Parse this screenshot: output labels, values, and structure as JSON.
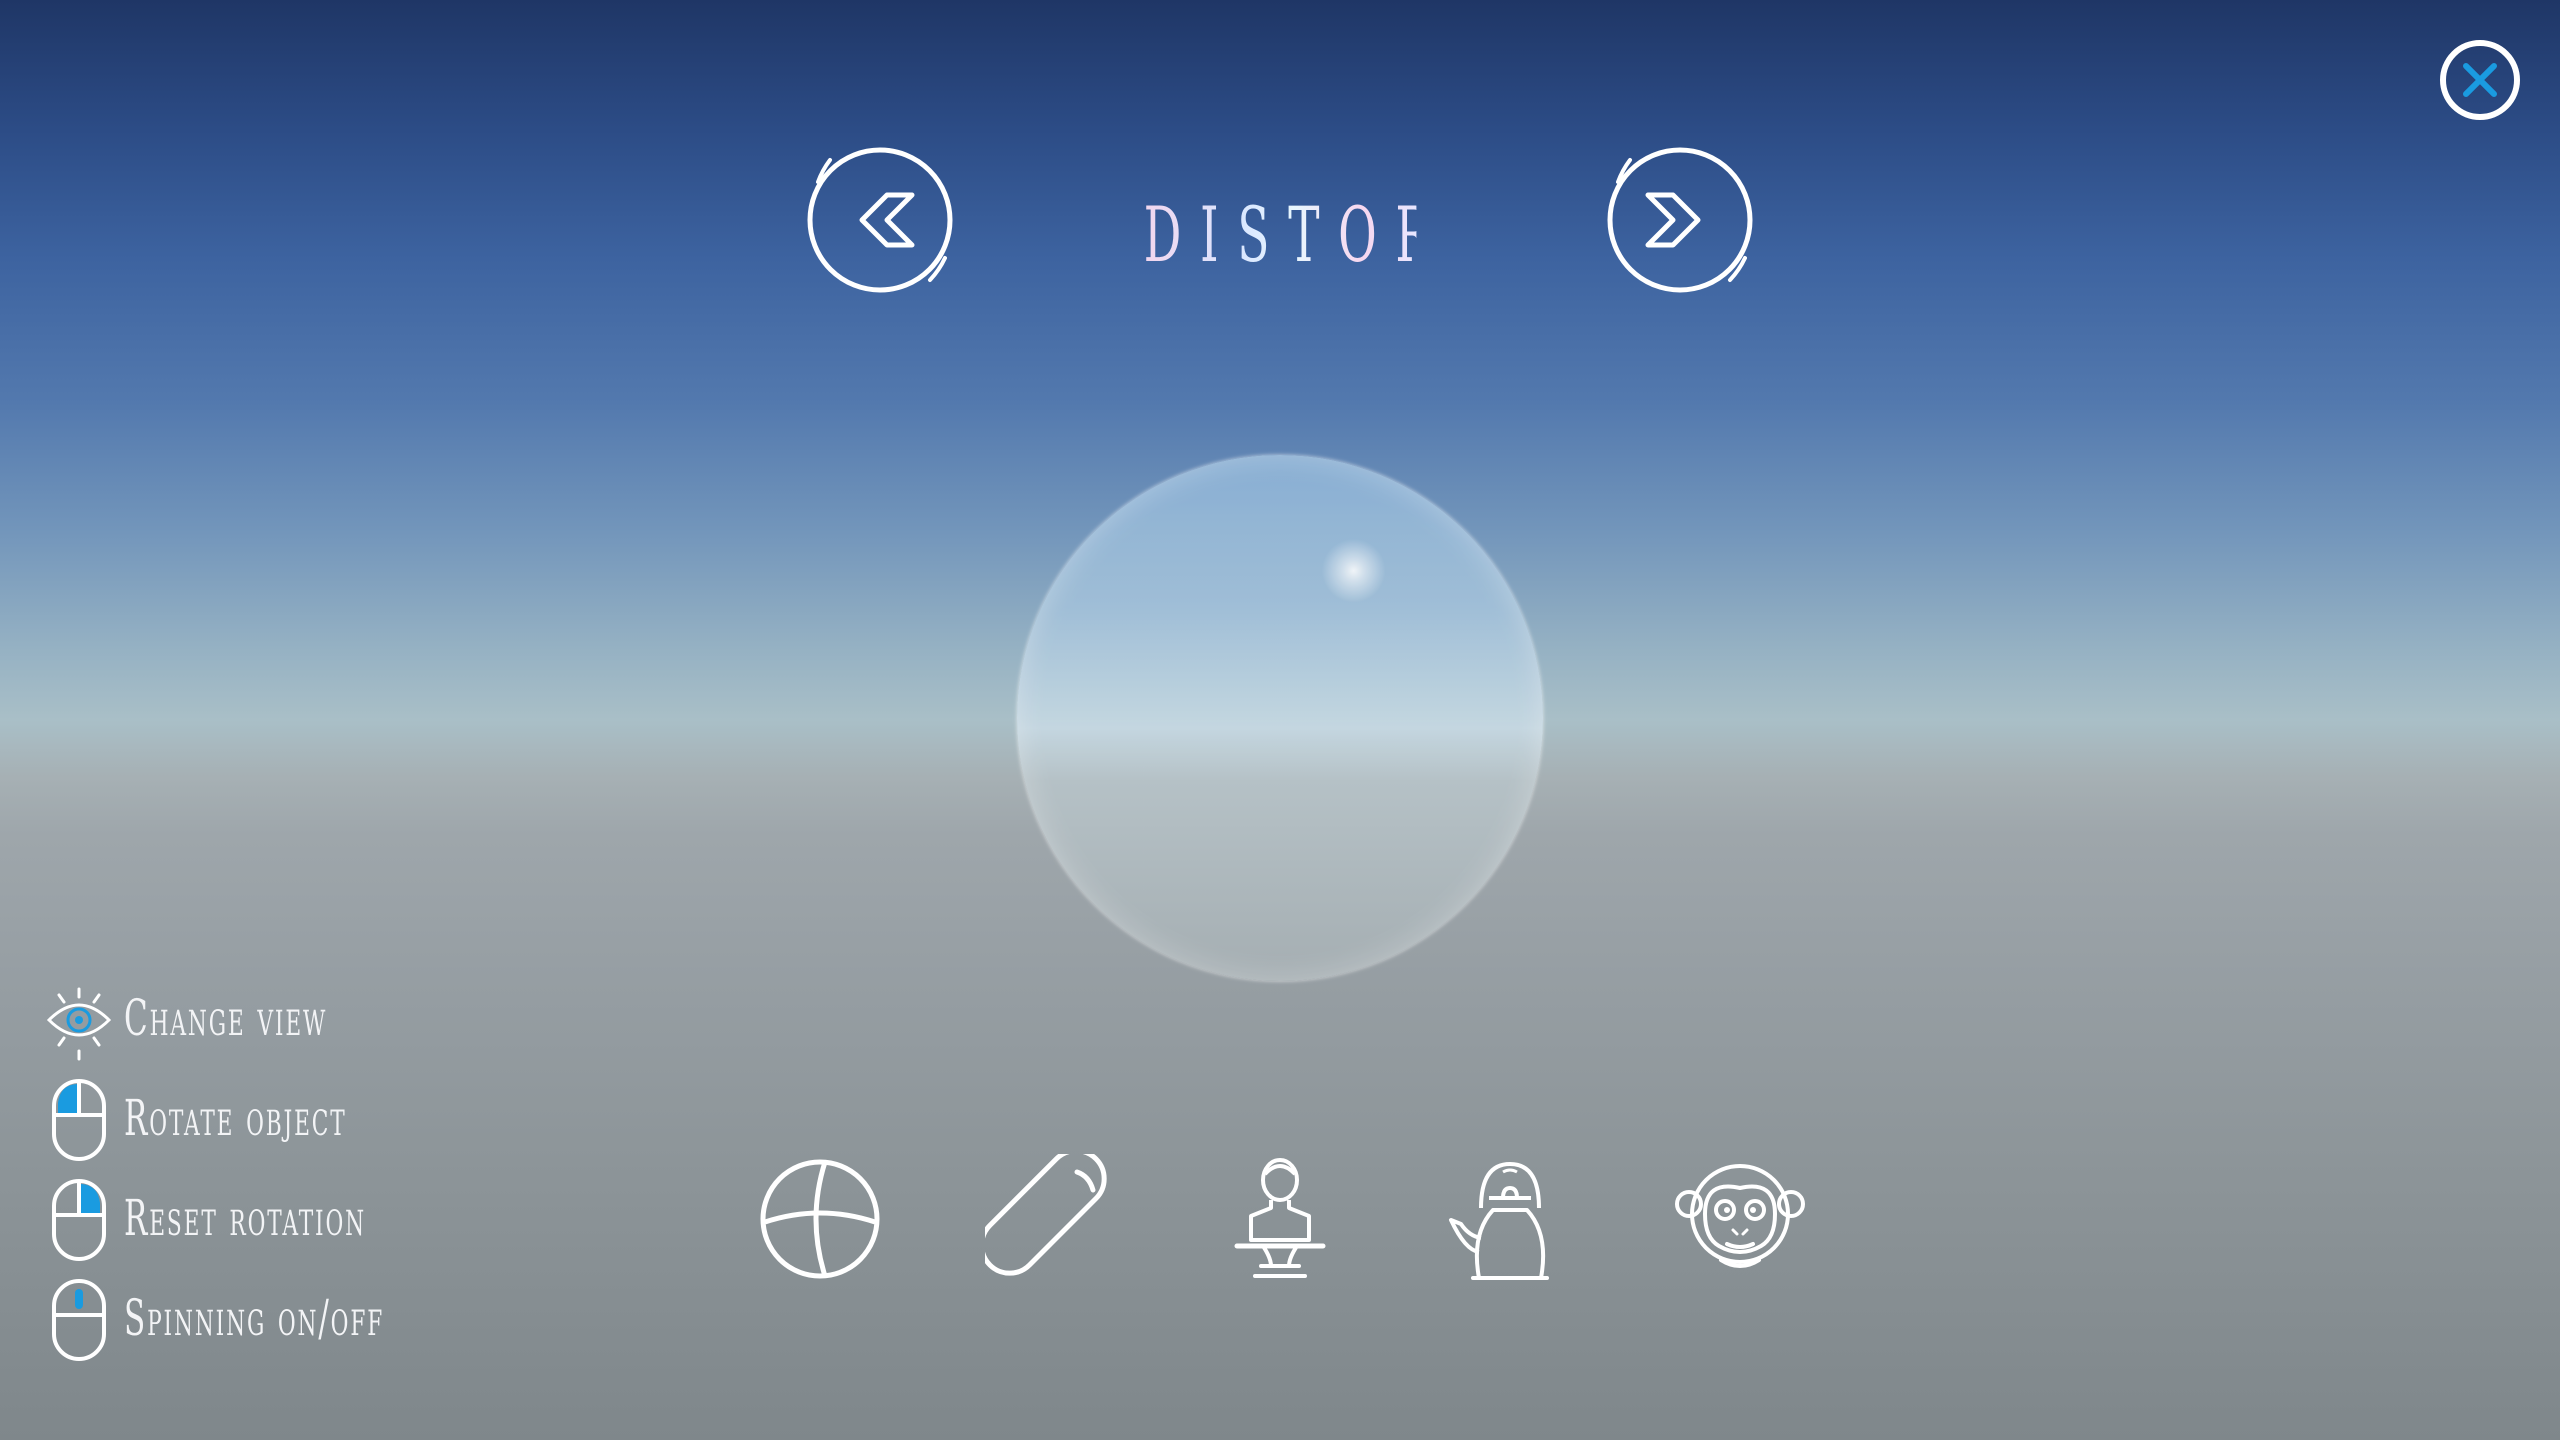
{
  "header": {
    "title": "DISTORED",
    "prev_icon": "chevron-left-icon",
    "next_icon": "chevron-right-icon"
  },
  "window": {
    "close_icon": "close-icon",
    "close_color": "#1a9be0"
  },
  "controls": [
    {
      "icon": "eye-icon",
      "label": "Change view"
    },
    {
      "icon": "mouse-left-button-icon",
      "label": "Rotate object"
    },
    {
      "icon": "mouse-right-button-icon",
      "label": "Reset rotation"
    },
    {
      "icon": "mouse-wheel-icon",
      "label": "Spinning on/off"
    }
  ],
  "accent_color": "#1a9be0",
  "shapes": [
    {
      "icon": "sphere-icon"
    },
    {
      "icon": "capsule-icon"
    },
    {
      "icon": "bust-icon"
    },
    {
      "icon": "teapot-icon"
    },
    {
      "icon": "monkey-icon"
    }
  ]
}
